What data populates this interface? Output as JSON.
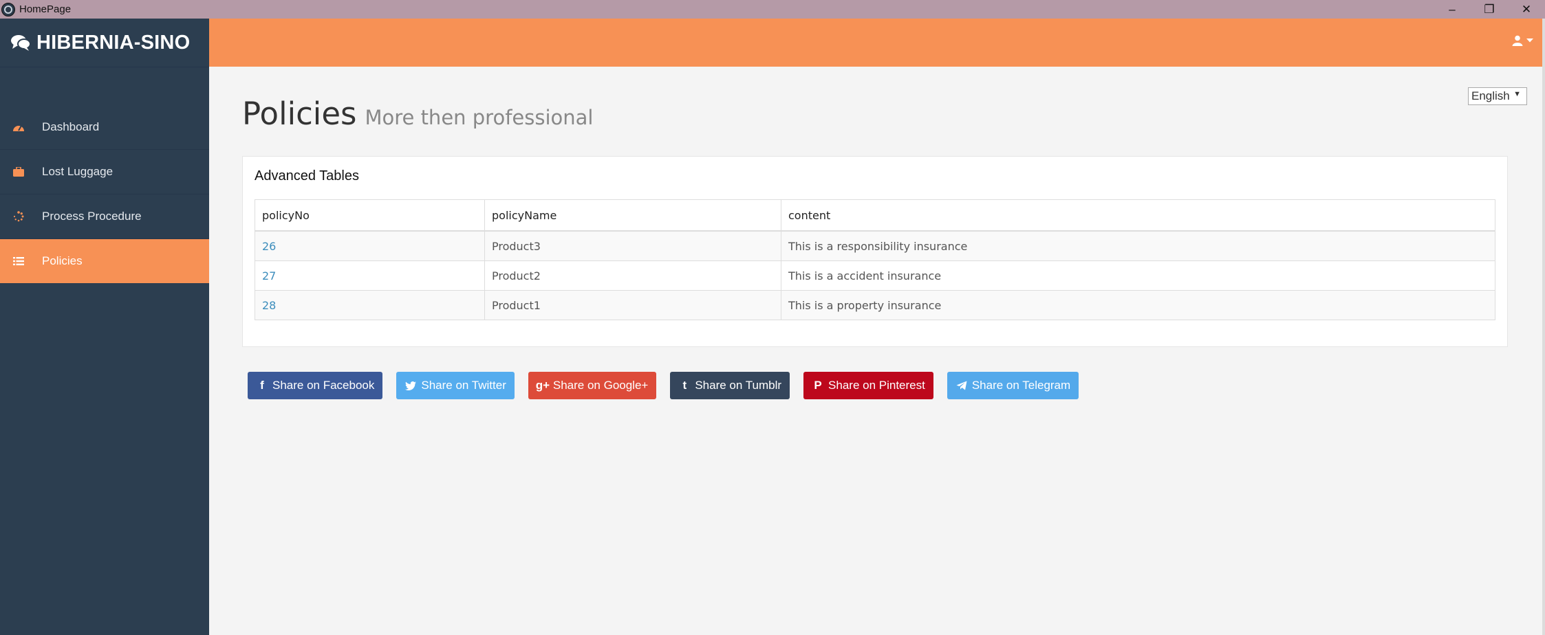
{
  "window": {
    "title": "HomePage",
    "controls": [
      "–",
      "❐",
      "✕"
    ]
  },
  "brand": {
    "name": "HIBERNIA-SINO"
  },
  "sidebar": {
    "items": [
      {
        "label": "Dashboard",
        "icon": "dashboard-icon",
        "active": false
      },
      {
        "label": "Lost Luggage",
        "icon": "briefcase-icon",
        "active": false
      },
      {
        "label": "Process Procedure",
        "icon": "spinner-icon",
        "active": false
      },
      {
        "label": "Policies",
        "icon": "list-icon",
        "active": true
      }
    ]
  },
  "language": {
    "selected": "English",
    "arrow": "▼"
  },
  "page": {
    "title": "Policies",
    "subtitle": "More then professional"
  },
  "panel": {
    "title": "Advanced Tables"
  },
  "table": {
    "headers": [
      "policyNo",
      "policyName",
      "content"
    ],
    "rows": [
      [
        "26",
        "Product3",
        "This is a responsibility insurance"
      ],
      [
        "27",
        "Product2",
        "This is a accident insurance"
      ],
      [
        "28",
        "Product1",
        "This is a property insurance"
      ]
    ]
  },
  "share": {
    "facebook": {
      "label": "Share on Facebook",
      "glyph": "f",
      "color": "#3b5998"
    },
    "twitter": {
      "label": "Share on Twitter",
      "color": "#55acee"
    },
    "google": {
      "label": "Share on Google+",
      "glyph": "g+",
      "color": "#dd4b39"
    },
    "tumblr": {
      "label": "Share on Tumblr",
      "glyph": "t",
      "color": "#35465c"
    },
    "pinterest": {
      "label": "Share on Pinterest",
      "glyph": "P",
      "color": "#bd081c"
    },
    "telegram": {
      "label": "Share on Telegram",
      "color": "#54a9eb"
    }
  },
  "colors": {
    "accent": "#f79155",
    "sidebar": "#2c3e50",
    "link": "#3c8dbc"
  }
}
